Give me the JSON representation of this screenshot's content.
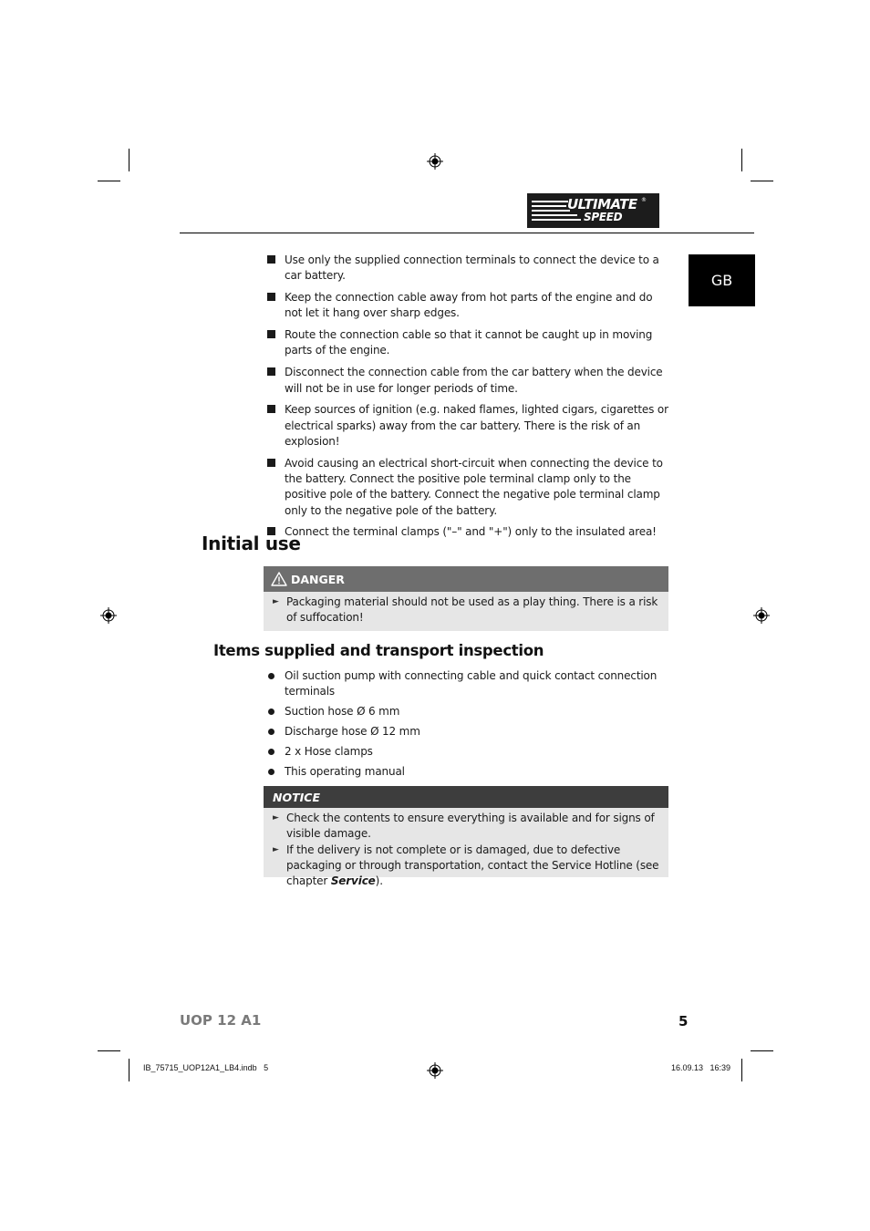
{
  "header": {
    "logo": {
      "line1": "ULTIMATE",
      "line2": "SPEED",
      "registered": "®"
    },
    "language_tab": "GB"
  },
  "safety_list": [
    "Use only the supplied connection terminals to connect the device to a car battery.",
    "Keep the connection cable away from hot parts of the engine and do not let it hang over sharp edges.",
    "Route the connection cable so that it cannot be caught up in moving parts of the engine.",
    "Disconnect the connection cable from the car battery when the device will not be in use for longer periods of time.",
    "Keep sources of ignition (e.g. naked flames, lighted cigars, cigarettes or electrical sparks) away from the car battery. There is the risk of an explosion!",
    "Avoid causing an electrical short-circuit when connecting the device to the battery. Connect the positive pole terminal clamp only to the positive pole of the battery. Connect the negative pole terminal clamp only to the negative pole of the battery.",
    "Connect the terminal clamps (\"–\" and \"+\") only to the insulated area!"
  ],
  "initial_use": {
    "title": "Initial use",
    "danger": {
      "icon": "warning-triangle-icon",
      "label": "DANGER",
      "items": [
        "Packaging material should not be used as a play thing. There is a risk of suffocation!"
      ]
    }
  },
  "items_supplied": {
    "title": "Items supplied and transport inspection",
    "items": [
      "Oil suction pump with connecting cable and quick contact connection terminals",
      "Suction hose Ø 6 mm",
      "Discharge hose Ø 12 mm",
      "2 x Hose clamps",
      "This operating manual"
    ],
    "notice": {
      "label": "NOTICE",
      "items": [
        {
          "text": "Check the contents to ensure everything is available and for signs of visible damage."
        },
        {
          "text": "If the delivery is not complete or is damaged, due to defective packaging or through transportation, contact the Service Hotline (see chapter ",
          "bold": "Service",
          "after": ")."
        }
      ]
    }
  },
  "footer": {
    "model": "UOP 12 A1",
    "page_number": "5",
    "slug_file": "IB_75715_UOP12A1_LB4.indb   5",
    "slug_date": "16.09.13   16:39"
  }
}
